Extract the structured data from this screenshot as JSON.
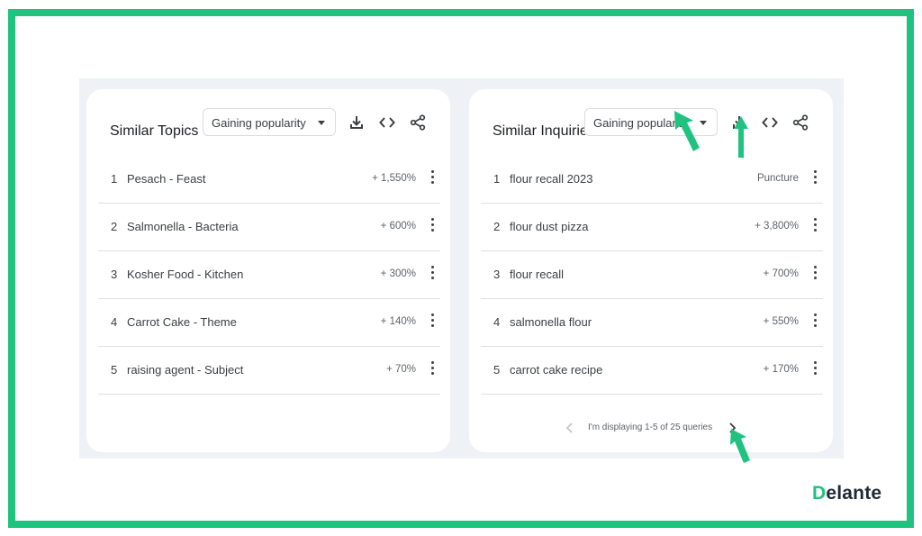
{
  "brand": {
    "first_letter": "D",
    "rest": "elante",
    "accent_color": "#1fc27e"
  },
  "panels": [
    {
      "title": "Similar Topics",
      "dropdown": {
        "value": "Gaining popularity"
      },
      "tools": [
        "download-icon",
        "embed-code-icon",
        "share-icon"
      ],
      "rows": [
        {
          "rank": "1",
          "name": "Pesach - Feast",
          "value": "+ 1,550%"
        },
        {
          "rank": "2",
          "name": "Salmonella - Bacteria",
          "value": "+ 600%"
        },
        {
          "rank": "3",
          "name": "Kosher Food - Kitchen",
          "value": "+ 300%"
        },
        {
          "rank": "4",
          "name": "Carrot Cake - Theme",
          "value": "+ 140%"
        },
        {
          "rank": "5",
          "name": "raising agent - Subject",
          "value": "+ 70%"
        }
      ]
    },
    {
      "title": "Similar Inquiries",
      "dropdown": {
        "value": "Gaining popularity"
      },
      "tools": [
        "download-icon",
        "embed-code-icon",
        "share-icon"
      ],
      "rows": [
        {
          "rank": "1",
          "name": "flour recall 2023",
          "value": "Puncture"
        },
        {
          "rank": "2",
          "name": "flour dust pizza",
          "value": "+ 3,800%"
        },
        {
          "rank": "3",
          "name": "flour recall",
          "value": "+ 700%"
        },
        {
          "rank": "4",
          "name": "salmonella flour",
          "value": "+ 550%"
        },
        {
          "rank": "5",
          "name": "carrot cake recipe",
          "value": "+ 170%"
        }
      ],
      "pagination": {
        "text": "I'm displaying 1-5 of 25 queries"
      }
    }
  ]
}
